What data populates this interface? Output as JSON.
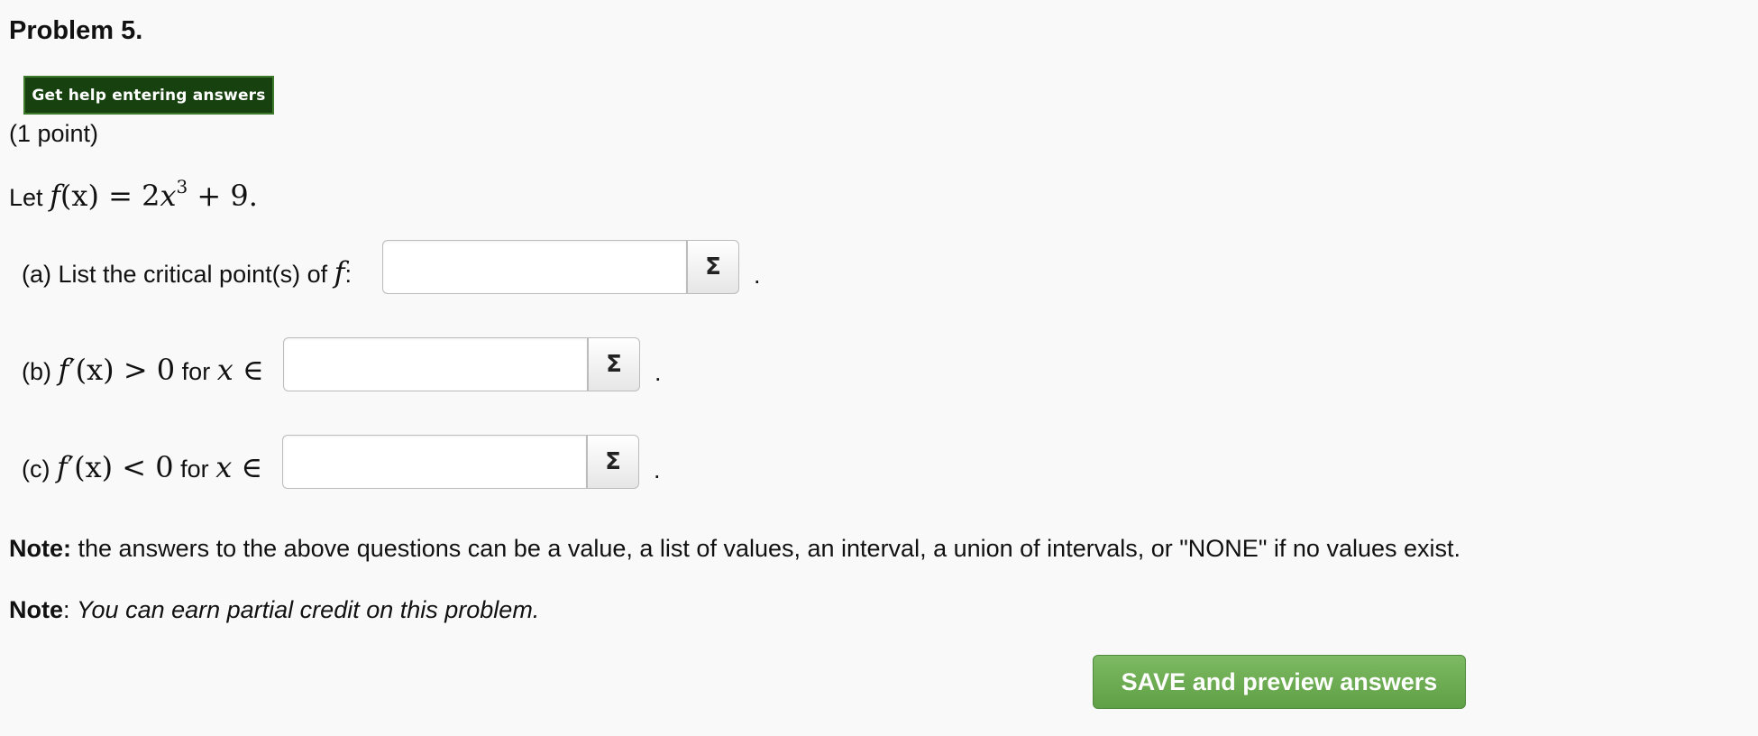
{
  "problem": {
    "title": "Problem 5.",
    "help_button": "Get help entering answers",
    "points": "(1 point)",
    "let_prefix": "Let",
    "function_def": {
      "lhs": "f",
      "arg": "(x)",
      "eq": " = 2",
      "var": "x",
      "exp": "3",
      "rest": " + 9."
    }
  },
  "parts": {
    "a": {
      "label": "(a) List the critical point(s) of",
      "fn": "f",
      "colon": ":",
      "value": "",
      "sigma": "Σ",
      "after": "."
    },
    "b": {
      "label": "(b)",
      "fn": "f",
      "rest": "′(x) > 0",
      "for_text": "for",
      "var": "x",
      "in": "∈",
      "value": "",
      "sigma": "Σ",
      "after": "."
    },
    "c": {
      "label": "(c)",
      "fn": "f",
      "rest": "′(x) < 0",
      "for_text": "for",
      "var": "x",
      "in": "∈",
      "value": "",
      "sigma": "Σ",
      "after": "."
    }
  },
  "notes": {
    "note1_bold": "Note:",
    "note1_text": " the answers to the above questions can be a value, a list of values, an interval, a union of intervals, or \"NONE\" if no values exist.",
    "note2_bold": "Note",
    "note2_colon": ": ",
    "note2_text": "You can earn partial credit on this problem."
  },
  "save_button": "SAVE and preview answers",
  "colors": {
    "help_bg": "#17410f",
    "save_bg": "#6aad4f"
  }
}
